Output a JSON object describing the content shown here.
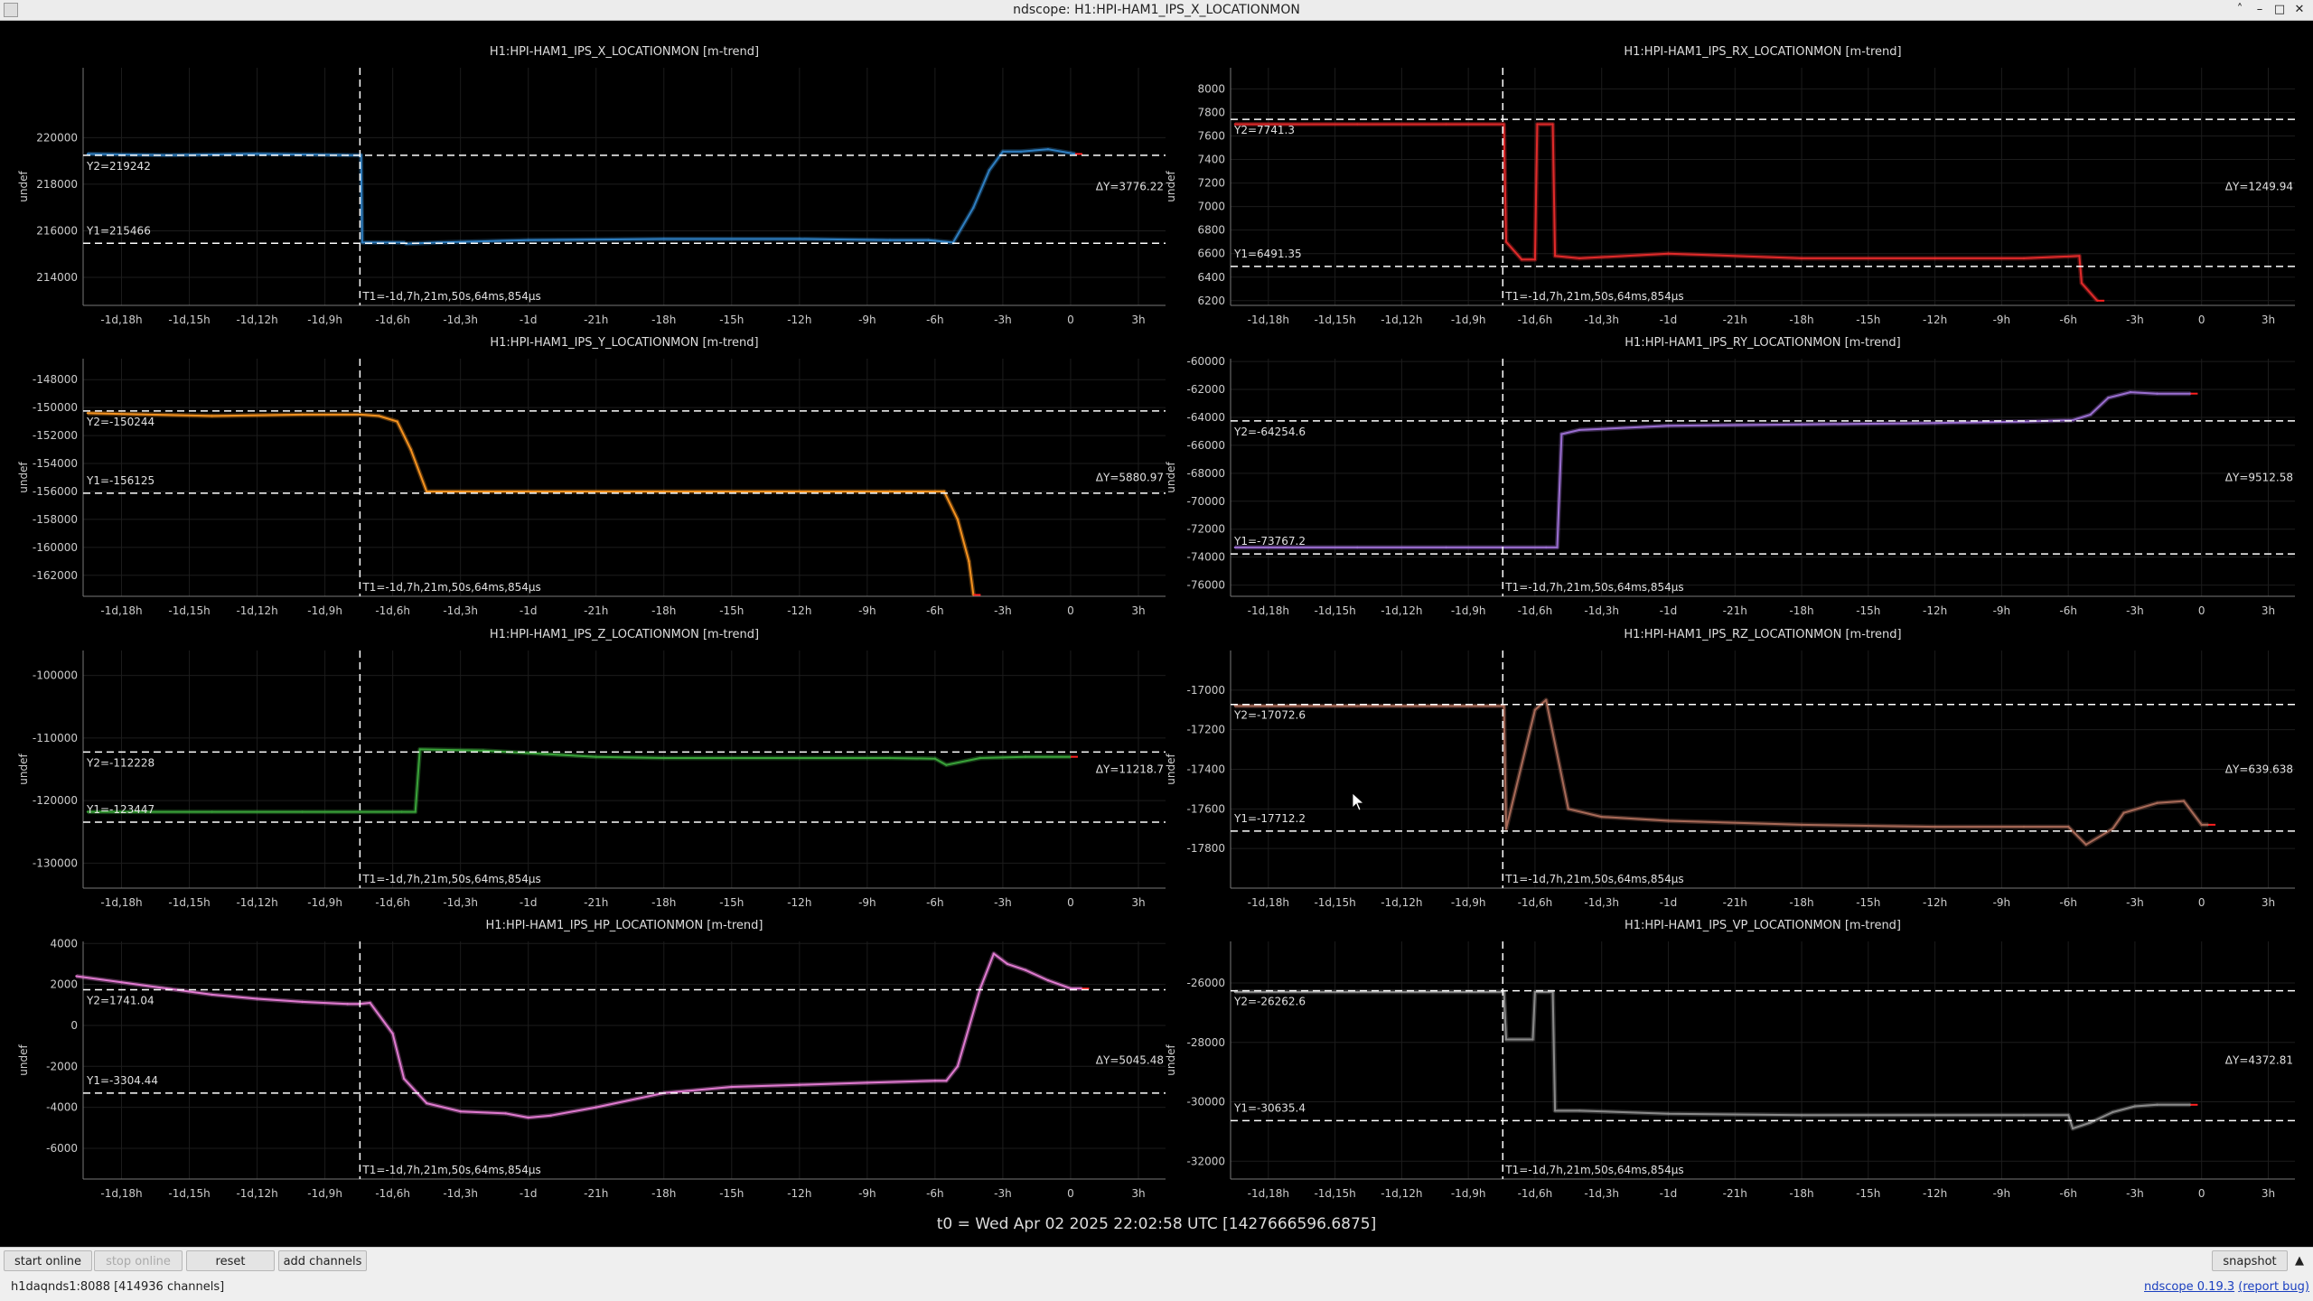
{
  "window": {
    "title": "ndscope: H1:HPI-HAM1_IPS_X_LOCATIONMON"
  },
  "status": {
    "connection": "h1daqnds1:8088  [414936 channels]",
    "version_link": "ndscope 0.19.3",
    "report_link": "(report bug)"
  },
  "toolbar": {
    "start_online": "start online",
    "stop_online": "stop online",
    "reset": "reset",
    "add_channels": "add channels",
    "snapshot": "snapshot"
  },
  "t0_label": "t0 = Wed Apr 02 2025 22:02:58 UTC [1427666596.6875]",
  "t1_label": "T1=-1d,7h,21m,50s,64ms,854μs",
  "colors": {
    "x": "#2f7fc1",
    "y": "#f5921f",
    "z": "#3aa33a",
    "hp": "#e07ad0",
    "rx": "#e02a2a",
    "ry": "#9a6ed0",
    "rz": "#a86a58",
    "vp": "#8a8a8a"
  },
  "x_ticks": [
    "-1d,18h",
    "-1d,15h",
    "-1d,12h",
    "-1d,9h",
    "-1d,6h",
    "-1d,3h",
    "-1d",
    "-21h",
    "-18h",
    "-15h",
    "-12h",
    "-9h",
    "-6h",
    "-3h",
    "0",
    "3h"
  ],
  "x_tick_hours": [
    -42,
    -39,
    -36,
    -33,
    -30,
    -27,
    -24,
    -21,
    -18,
    -15,
    -12,
    -9,
    -6,
    -3,
    0,
    3
  ],
  "plots": [
    {
      "id": "x",
      "title": "H1:HPI-HAM1_IPS_X_LOCATIONMON [m-trend]",
      "ylabel": "undef",
      "ylim": [
        212800,
        223000
      ],
      "yticks": [
        214000,
        216000,
        218000,
        220000
      ],
      "ytick_labels": [
        "214000",
        "216000",
        "218000",
        "220000"
      ],
      "cursor_y1": 215466,
      "y1_label": "Y1=215466",
      "cursor_y2": 219242,
      "y2_label": "Y2=219242",
      "dy_label": "ΔY=3776.22",
      "chart_data": {
        "type": "line",
        "x_hours": [
          -43.5,
          -40,
          -36,
          -32,
          -31.4,
          -31.35,
          -29.5,
          -29.4,
          -28,
          -24,
          -18,
          -12,
          -8,
          -6.3,
          -5.2,
          -4.3,
          -3.6,
          -3.0,
          -2.2,
          -1.0,
          0.2
        ],
        "y": [
          219300,
          219250,
          219300,
          219250,
          219250,
          215500,
          215500,
          215450,
          215500,
          215600,
          215650,
          215650,
          215600,
          215600,
          215500,
          217000,
          218600,
          219400,
          219400,
          219500,
          219300
        ]
      }
    },
    {
      "id": "rx",
      "title": "H1:HPI-HAM1_IPS_RX_LOCATIONMON [m-trend]",
      "ylabel": "undef",
      "ylim": [
        6160,
        8180
      ],
      "yticks": [
        6200,
        6400,
        6600,
        6800,
        7000,
        7200,
        7400,
        7600,
        7800,
        8000
      ],
      "ytick_labels": [
        "6200",
        "6400",
        "6600",
        "6800",
        "7000",
        "7200",
        "7400",
        "7600",
        "7800",
        "8000"
      ],
      "cursor_y1": 6491.35,
      "y1_label": "Y1=6491.35",
      "cursor_y2": 7741.3,
      "y2_label": "Y2=7741.3",
      "dy_label": "ΔY=1249.94",
      "chart_data": {
        "type": "line",
        "x_hours": [
          -43.5,
          -38,
          -34,
          -31.4,
          -31.3,
          -30.6,
          -30.0,
          -29.9,
          -29.2,
          -29.1,
          -28.0,
          -24,
          -18,
          -12,
          -8,
          -5.5,
          -5.4,
          -4.7
        ],
        "y": [
          7700,
          7700,
          7700,
          7700,
          6700,
          6550,
          6550,
          7700,
          7700,
          6580,
          6560,
          6600,
          6560,
          6560,
          6560,
          6580,
          6350,
          6200
        ]
      }
    },
    {
      "id": "y",
      "title": "H1:HPI-HAM1_IPS_Y_LOCATIONMON [m-trend]",
      "ylabel": "undef",
      "ylim": [
        -163500,
        -146500
      ],
      "yticks": [
        -162000,
        -160000,
        -158000,
        -156000,
        -154000,
        -152000,
        -150000,
        -148000
      ],
      "ytick_labels": [
        "-162000",
        "-160000",
        "-158000",
        "-156000",
        "-154000",
        "-152000",
        "-150000",
        "-148000"
      ],
      "cursor_y1": -156125,
      "y1_label": "Y1=-156125",
      "cursor_y2": -150244,
      "y2_label": "Y2=-150244",
      "dy_label": "ΔY=5880.97",
      "chart_data": {
        "type": "line",
        "x_hours": [
          -43.5,
          -38,
          -34,
          -31.4,
          -30.6,
          -29.8,
          -29.2,
          -28.5,
          -24,
          -18,
          -12,
          -8,
          -6,
          -5.6,
          -5.0,
          -4.5,
          -4.3
        ],
        "y": [
          -150400,
          -150600,
          -150500,
          -150500,
          -150600,
          -151000,
          -153000,
          -156000,
          -156000,
          -156000,
          -156000,
          -156000,
          -156000,
          -156000,
          -158000,
          -161000,
          -163400
        ]
      }
    },
    {
      "id": "ry",
      "title": "H1:HPI-HAM1_IPS_RY_LOCATIONMON [m-trend]",
      "ylabel": "undef",
      "ylim": [
        -76800,
        -59800
      ],
      "yticks": [
        -76000,
        -74000,
        -72000,
        -70000,
        -68000,
        -66000,
        -64000,
        -62000,
        -60000
      ],
      "ytick_labels": [
        "-76000",
        "-74000",
        "-72000",
        "-70000",
        "-68000",
        "-66000",
        "-64000",
        "-62000",
        "-60000"
      ],
      "cursor_y1": -73767.2,
      "y1_label": "Y1=-73767.2",
      "cursor_y2": -64254.6,
      "y2_label": "Y2=-64254.6",
      "dy_label": "ΔY=9512.58",
      "chart_data": {
        "type": "line",
        "x_hours": [
          -43.5,
          -38,
          -34,
          -31.5,
          -29.5,
          -29.0,
          -28.8,
          -28.0,
          -24,
          -18,
          -12,
          -8,
          -5.8,
          -5.0,
          -4.2,
          -3.2,
          -2.0,
          -0.5
        ],
        "y": [
          -73300,
          -73300,
          -73300,
          -73300,
          -73300,
          -73300,
          -65200,
          -64900,
          -64600,
          -64500,
          -64400,
          -64300,
          -64200,
          -63800,
          -62600,
          -62200,
          -62300,
          -62300
        ]
      }
    },
    {
      "id": "z",
      "title": "H1:HPI-HAM1_IPS_Z_LOCATIONMON [m-trend]",
      "ylabel": "undef",
      "ylim": [
        -134000,
        -96000
      ],
      "yticks": [
        -130000,
        -120000,
        -110000,
        -100000
      ],
      "ytick_labels": [
        "-130000",
        "-120000",
        "-110000",
        "-100000"
      ],
      "cursor_y1": -123447,
      "y1_label": "Y1=-123447",
      "cursor_y2": -112228,
      "y2_label": "Y2=-112228",
      "dy_label": "ΔY=11218.7",
      "chart_data": {
        "type": "line",
        "x_hours": [
          -43.5,
          -38,
          -34,
          -31.4,
          -29.6,
          -29.0,
          -28.8,
          -26,
          -24,
          -21,
          -18,
          -12,
          -8,
          -6,
          -5.5,
          -4.0,
          -2.0,
          0.0
        ],
        "y": [
          -121800,
          -121800,
          -121800,
          -121800,
          -121800,
          -121800,
          -111800,
          -112000,
          -112400,
          -113000,
          -113200,
          -113200,
          -113200,
          -113300,
          -114300,
          -113200,
          -113000,
          -113000
        ]
      }
    },
    {
      "id": "rz",
      "title": "H1:HPI-HAM1_IPS_RZ_LOCATIONMON [m-trend]",
      "ylabel": "undef",
      "ylim": [
        -18000,
        -16800
      ],
      "yticks": [
        -17800,
        -17600,
        -17400,
        -17200,
        -17000
      ],
      "ytick_labels": [
        "-17800",
        "-17600",
        "-17400",
        "-17200",
        "-17000"
      ],
      "cursor_y1": -17712.2,
      "y1_label": "Y1=-17712.2",
      "cursor_y2": -17072.6,
      "y2_label": "Y2=-17072.6",
      "dy_label": "ΔY=639.638",
      "chart_data": {
        "type": "line",
        "x_hours": [
          -43.5,
          -38,
          -34,
          -31.4,
          -31.3,
          -30,
          -29.5,
          -28.5,
          -27,
          -24,
          -18,
          -12,
          -8,
          -6,
          -5.2,
          -4.0,
          -3.5,
          -2.0,
          -0.8,
          0.0,
          0.3
        ],
        "y": [
          -17080,
          -17080,
          -17080,
          -17080,
          -17700,
          -17100,
          -17050,
          -17600,
          -17640,
          -17660,
          -17680,
          -17690,
          -17690,
          -17690,
          -17780,
          -17700,
          -17620,
          -17570,
          -17560,
          -17680,
          -17680
        ]
      }
    },
    {
      "id": "hp",
      "title": "H1:HPI-HAM1_IPS_HP_LOCATIONMON [m-trend]",
      "ylabel": "undef",
      "ylim": [
        -7500,
        4100
      ],
      "yticks": [
        -6000,
        -4000,
        -2000,
        0,
        2000,
        4000
      ],
      "ytick_labels": [
        "-6000",
        "-4000",
        "-2000",
        "0",
        "2000",
        "4000"
      ],
      "cursor_y1": -3304.44,
      "y1_label": "Y1=-3304.44",
      "cursor_y2": 1741.04,
      "y2_label": "Y2=1741.04",
      "dy_label": "ΔY=5045.48",
      "chart_data": {
        "type": "line",
        "x_hours": [
          -44,
          -42,
          -40,
          -38,
          -36,
          -34,
          -32,
          -31.5,
          -31,
          -30,
          -29.5,
          -28.5,
          -27,
          -25,
          -24,
          -23,
          -21,
          -18,
          -15,
          -12,
          -9,
          -6,
          -5.5,
          -5,
          -4,
          -3.4,
          -2.8,
          -2.0,
          -1,
          0,
          0.5
        ],
        "y": [
          2400,
          2100,
          1800,
          1500,
          1300,
          1150,
          1050,
          1050,
          1100,
          -400,
          -2600,
          -3800,
          -4200,
          -4300,
          -4500,
          -4400,
          -4000,
          -3300,
          -3000,
          -2900,
          -2800,
          -2700,
          -2700,
          -2000,
          1800,
          3500,
          3000,
          2700,
          2200,
          1800,
          1800
        ]
      }
    },
    {
      "id": "vp",
      "title": "H1:HPI-HAM1_IPS_VP_LOCATIONMON [m-trend]",
      "ylabel": "undef",
      "ylim": [
        -32600,
        -24600
      ],
      "yticks": [
        -32000,
        -30000,
        -28000,
        -26000
      ],
      "ytick_labels": [
        "-32000",
        "-30000",
        "-28000",
        "-26000"
      ],
      "cursor_y1": -30635.4,
      "y1_label": "Y1=-30635.4",
      "cursor_y2": -26262.6,
      "y2_label": "Y2=-26262.6",
      "dy_label": "ΔY=4372.81",
      "chart_data": {
        "type": "line",
        "x_hours": [
          -43.5,
          -38,
          -34,
          -31.4,
          -31.3,
          -30.1,
          -30.0,
          -29.2,
          -29.1,
          -28,
          -24,
          -18,
          -12,
          -8,
          -6,
          -5.8,
          -5.0,
          -4.0,
          -3.0,
          -2.0,
          -0.5
        ],
        "y": [
          -26300,
          -26300,
          -26300,
          -26300,
          -27900,
          -27900,
          -26300,
          -26300,
          -30300,
          -30300,
          -30400,
          -30450,
          -30450,
          -30450,
          -30450,
          -30900,
          -30700,
          -30350,
          -30150,
          -30100,
          -30100
        ]
      }
    }
  ]
}
